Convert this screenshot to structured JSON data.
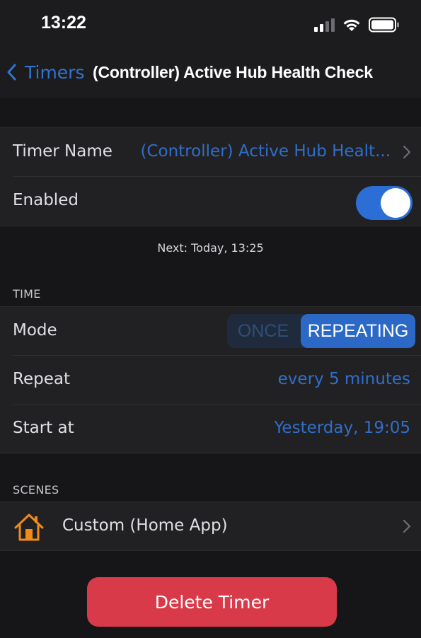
{
  "status_bar": {
    "time": "13:22"
  },
  "nav": {
    "back_label": "Timers",
    "title": "(Controller) Active Hub Health Check"
  },
  "timer": {
    "name_label": "Timer Name",
    "name_value": "(Controller) Active Hub Healt...",
    "enabled_label": "Enabled",
    "enabled": true,
    "next_run": "Next: Today, 13:25"
  },
  "time_section": {
    "header": "TIME",
    "mode_label": "Mode",
    "mode_options": [
      "ONCE",
      "REPEATING"
    ],
    "mode_selected": "REPEATING",
    "repeat_label": "Repeat",
    "repeat_value": "every 5 minutes",
    "start_label": "Start at",
    "start_value": "Yesterday, 19:05"
  },
  "scenes_section": {
    "header": "SCENES",
    "items": [
      {
        "label": "Custom (Home App)",
        "icon": "house-icon"
      }
    ]
  },
  "delete_label": "Delete Timer",
  "colors": {
    "accent": "#2f6fc9",
    "toggle_on": "#2b6fd6",
    "destructive": "#d93a49",
    "house_icon": "#f08a1c"
  }
}
